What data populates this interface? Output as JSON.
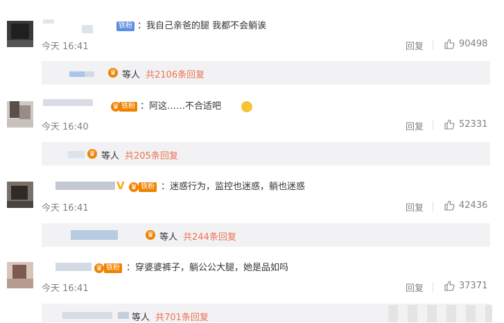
{
  "comments": [
    {
      "badge": "铁粉",
      "text": "：我自己亲爸的腿 我都不会躺诶",
      "time": "今天 16:41",
      "reply_label": "回复",
      "likes": "90498",
      "sub": {
        "who": "等人",
        "count": "共2106条回复"
      }
    },
    {
      "badge": "铁粉",
      "text": "：阿这……不合适吧",
      "time": "今天 16:40",
      "reply_label": "回复",
      "likes": "52331",
      "sub": {
        "who": "等人",
        "count": "共205条回复"
      }
    },
    {
      "badge": "铁粉",
      "text": "：迷惑行为，监控也迷惑，躺也迷惑",
      "time": "今天 16:41",
      "reply_label": "回复",
      "likes": "42436",
      "sub": {
        "who": "等人",
        "count": "共244条回复"
      }
    },
    {
      "badge": "铁粉",
      "text": "：穿婆婆裤子，躺公公大腿，她是品如吗",
      "time": "今天 16:41",
      "reply_label": "回复",
      "likes": "37371",
      "sub": {
        "who": "等人",
        "count": "共701条回复"
      }
    }
  ],
  "colors": {
    "badge_blue": "#5d8fe0",
    "badge_orange": "#f08200",
    "reply_count": "#eb7350",
    "bar_bg": "#f2f2f5"
  },
  "icons": {
    "like": "thumbs-up-icon",
    "fan": "fan-crown-icon",
    "emoji": "smile-emoji-icon"
  }
}
